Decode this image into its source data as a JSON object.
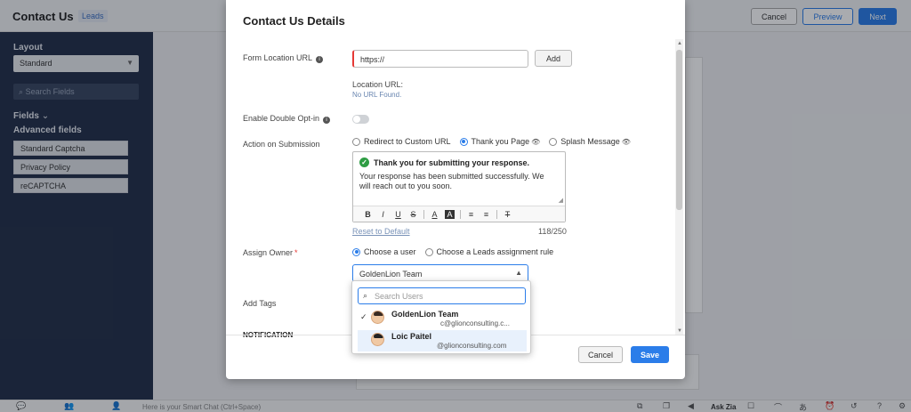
{
  "page": {
    "title": "Contact Us",
    "module": "Leads",
    "cancel_label": "Cancel",
    "preview_label": "Preview",
    "next_label": "Next"
  },
  "left_panel": {
    "layout_label": "Layout",
    "layout_value": "Standard",
    "search_placeholder": "Search Fields",
    "fields_label": "Fields",
    "advanced_label": "Advanced fields",
    "items": [
      "Standard Captcha",
      "Privacy Policy",
      "reCAPTCHA"
    ]
  },
  "bottom_bar": {
    "chat_placeholder": "Here is your Smart Chat (Ctrl+Space)",
    "ask_zia": "Ask Zia"
  },
  "modal": {
    "title": "Contact Us Details",
    "form_location": {
      "label": "Form Location URL",
      "placeholder": "https://",
      "add_label": "Add",
      "location_label": "Location URL:",
      "location_value": "No URL Found."
    },
    "double_optin": {
      "label": "Enable Double Opt-in",
      "enabled": false
    },
    "action_on_submission": {
      "label": "Action on Submission",
      "options": [
        "Redirect to Custom URL",
        "Thank you Page",
        "Splash Message"
      ],
      "selected": "Thank you Page"
    },
    "editor": {
      "heading": "Thank you for submitting your response.",
      "body": "Your response has been submitted successfully. We will reach out to you soon.",
      "toolbar": [
        "B",
        "I",
        "U",
        "S",
        "A",
        "A",
        "≡",
        "≡",
        "T"
      ],
      "reset_label": "Reset to Default",
      "char_count": "118/250"
    },
    "assign_owner": {
      "label": "Assign Owner",
      "required_mark": "*",
      "options": [
        "Choose a user",
        "Choose a Leads assignment rule"
      ],
      "selected": "Choose a user",
      "value": "GoldenLion Team"
    },
    "add_tags_label": "Add Tags",
    "notification_label": "NOTIFICATION",
    "cancel_label": "Cancel",
    "save_label": "Save"
  },
  "dropdown": {
    "search_placeholder": "Search Users",
    "users": [
      {
        "name": "GoldenLion Team",
        "email": "c@glionconsulting.c...",
        "selected": true
      },
      {
        "name": "Loic Paitel",
        "email": "@glionconsulting.com",
        "selected": false
      }
    ]
  }
}
